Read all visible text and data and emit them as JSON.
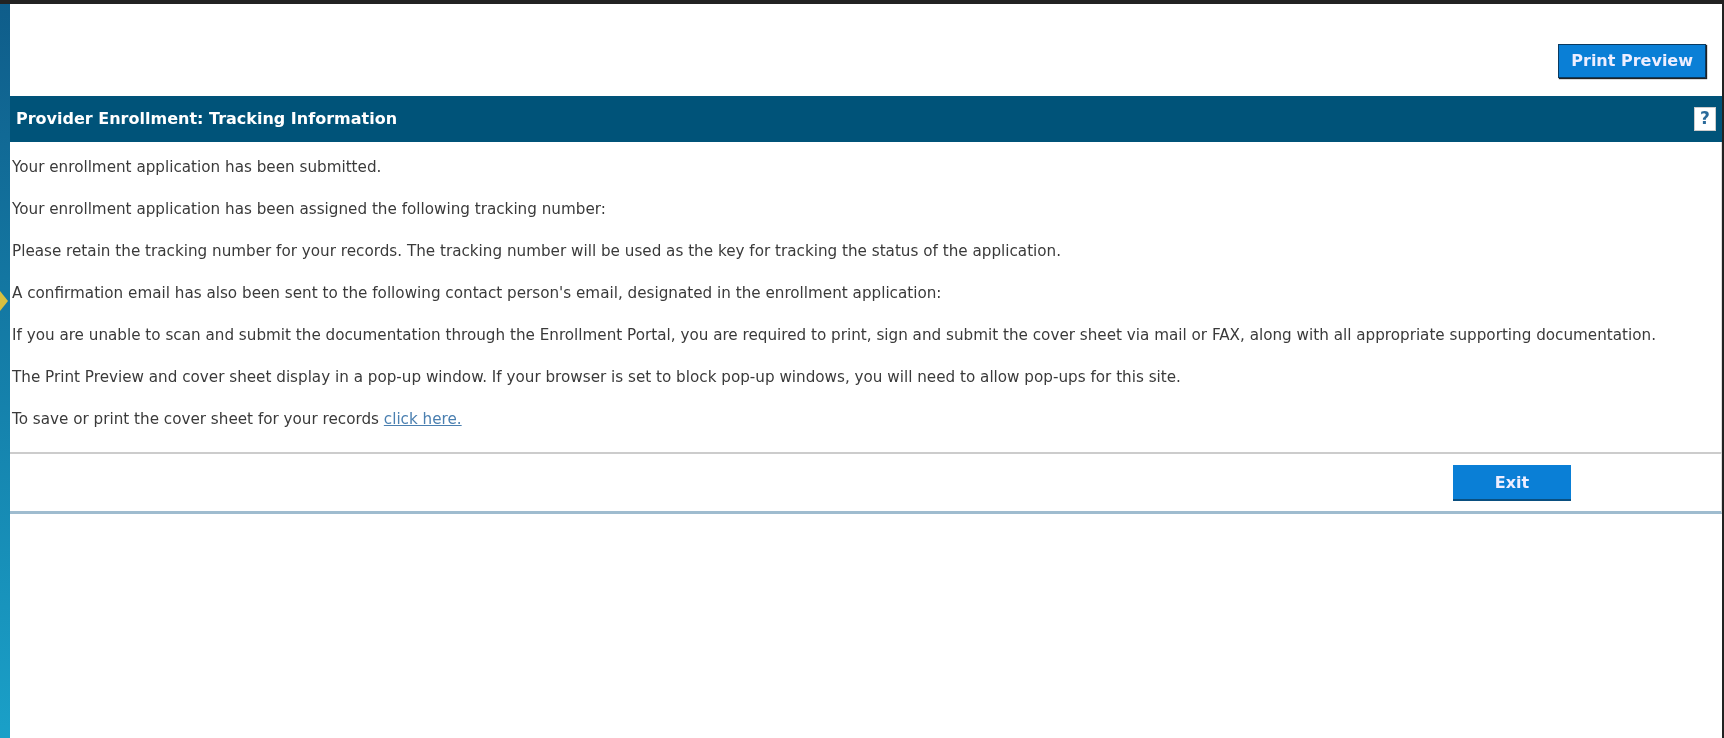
{
  "print_preview_button": "Print Preview",
  "panel": {
    "title": "Provider Enrollment: Tracking Information",
    "help_button": "?",
    "paragraphs": [
      {
        "text": "Your enrollment application has been submitted."
      },
      {
        "text": "Your enrollment application has been assigned the following tracking number:"
      },
      {
        "text": "Please retain the tracking number for your records. The tracking number will be used as the key for tracking the status of the application."
      },
      {
        "text": "A confirmation email has also been sent to the following contact person's email, designated in the enrollment application:"
      },
      {
        "text": "If you are unable to scan and submit the documentation through the Enrollment Portal, you are required to print, sign and submit the cover sheet via mail or FAX, along with all appropriate supporting documentation."
      },
      {
        "text": "The Print Preview and cover sheet display in a pop-up window. If your browser is set to block pop-up windows, you will need to allow pop-ups for this site."
      },
      {
        "text": "To save or print the cover sheet for your records",
        "link": "click here."
      }
    ],
    "exit_button": "Exit"
  }
}
